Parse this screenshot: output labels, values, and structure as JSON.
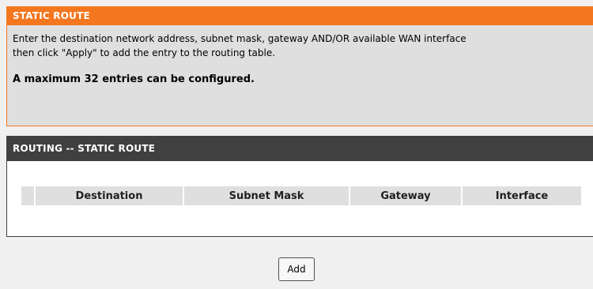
{
  "info": {
    "title": "STATIC ROUTE",
    "description_line1": "Enter the destination network address, subnet mask, gateway AND/OR available WAN interface",
    "description_line2": "then click \"Apply\" to add the entry to the routing table.",
    "note": "A maximum 32 entries can be configured."
  },
  "routing": {
    "title": "ROUTING -- STATIC ROUTE",
    "columns": [
      "",
      "Destination",
      "Subnet Mask",
      "Gateway",
      "Interface"
    ],
    "rows": []
  },
  "actions": {
    "add_label": "Add"
  },
  "colors": {
    "accent": "#f4761f",
    "dark_header": "#404040"
  }
}
